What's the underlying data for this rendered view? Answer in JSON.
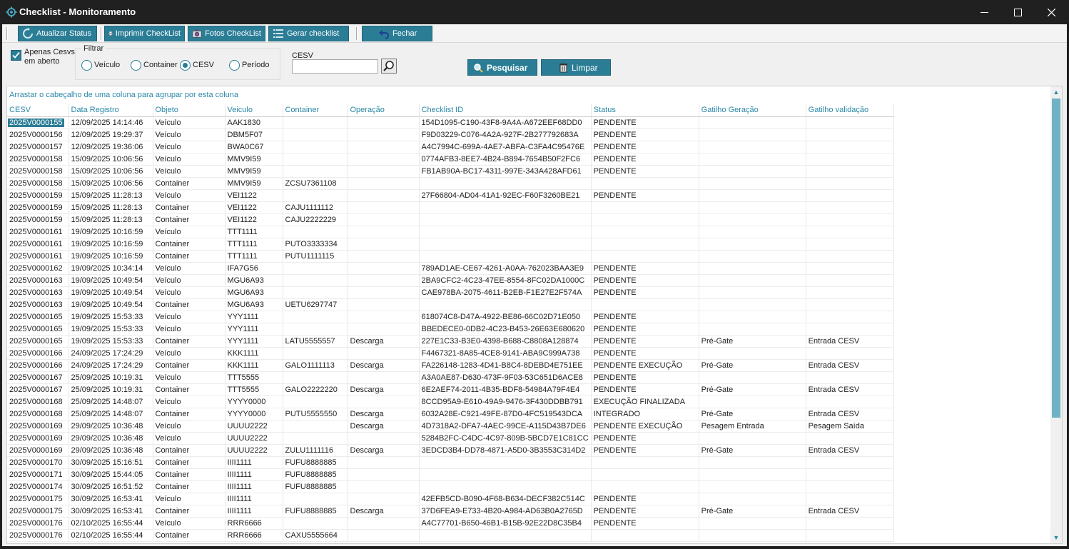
{
  "window": {
    "title": "Checklist - Monitoramento",
    "minimize_icon": "minimize-icon",
    "maximize_icon": "maximize-icon",
    "close_icon": "close-icon"
  },
  "toolbar": {
    "atualizar_label": "Atualizar Status",
    "imprimir_label": "Imprimir CheckList",
    "fotos_label": "Fotos CheckList",
    "gerar_label": "Gerar checklist",
    "fechar_label": "Fechar"
  },
  "filters": {
    "apenas_label": "Apenas Cesvs em aberto",
    "apenas_checked": true,
    "filtrar_title": "Filtrar",
    "options": [
      "Veículo",
      "Container",
      "CESV",
      "Período"
    ],
    "selected": "CESV",
    "cesv_label": "CESV",
    "cesv_value": "",
    "pesquisar_label": "Pesquisar",
    "limpar_label": "Limpar"
  },
  "grid": {
    "group_hint": "Arrastar o cabeçalho de uma coluna para agrupar por esta coluna",
    "columns": [
      "CESV",
      "Data Registro",
      "Objeto",
      "Veiculo",
      "Container",
      "Operação",
      "Checklist ID",
      "Status",
      "Gatilho Geração",
      "Gatilho validação"
    ],
    "rows": [
      [
        "2025V0000155",
        "12/09/2025 14:14:46",
        "Veículo",
        "AAK1830",
        "",
        "",
        "154D1095-C190-43F8-9A4A-A672EEF68DD0",
        "PENDENTE",
        "",
        ""
      ],
      [
        "2025V0000156",
        "12/09/2025 19:29:37",
        "Veículo",
        "DBM5F07",
        "",
        "",
        "F9D03229-C076-4A2A-927F-2B277792683A",
        "PENDENTE",
        "",
        ""
      ],
      [
        "2025V0000157",
        "12/09/2025 19:36:06",
        "Veículo",
        "BWA0C67",
        "",
        "",
        "A4C7994C-699A-4AE7-ABFA-C3FA4C95476E",
        "PENDENTE",
        "",
        ""
      ],
      [
        "2025V0000158",
        "15/09/2025 10:06:56",
        "Veículo",
        "MMV9I59",
        "",
        "",
        "0774AFB3-8EE7-4B24-B894-7654B50F2FC6",
        "PENDENTE",
        "",
        ""
      ],
      [
        "2025V0000158",
        "15/09/2025 10:06:56",
        "Veículo",
        "MMV9I59",
        "",
        "",
        "FB1AB90A-BC17-4311-997E-343A428AFD61",
        "PENDENTE",
        "",
        ""
      ],
      [
        "2025V0000158",
        "15/09/2025 10:06:56",
        "Container",
        "MMV9I59",
        "ZCSU7361108",
        "",
        "",
        "",
        "",
        ""
      ],
      [
        "2025V0000159",
        "15/09/2025 11:28:13",
        "Veículo",
        "VEI1122",
        "",
        "",
        "27F66804-AD04-41A1-92EC-F60F3260BE21",
        "PENDENTE",
        "",
        ""
      ],
      [
        "2025V0000159",
        "15/09/2025 11:28:13",
        "Container",
        "VEI1122",
        "CAJU1111112",
        "",
        "",
        "",
        "",
        ""
      ],
      [
        "2025V0000159",
        "15/09/2025 11:28:13",
        "Container",
        "VEI1122",
        "CAJU2222229",
        "",
        "",
        "",
        "",
        ""
      ],
      [
        "2025V0000161",
        "19/09/2025 10:16:59",
        "Veículo",
        "TTT1111",
        "",
        "",
        "",
        "",
        "",
        ""
      ],
      [
        "2025V0000161",
        "19/09/2025 10:16:59",
        "Container",
        "TTT1111",
        "PUTO3333334",
        "",
        "",
        "",
        "",
        ""
      ],
      [
        "2025V0000161",
        "19/09/2025 10:16:59",
        "Container",
        "TTT1111",
        "PUTU1111115",
        "",
        "",
        "",
        "",
        ""
      ],
      [
        "2025V0000162",
        "19/09/2025 10:34:14",
        "Veículo",
        "IFA7G56",
        "",
        "",
        "789AD1AE-CE67-4261-A0AA-762023BAA3E9",
        "PENDENTE",
        "",
        ""
      ],
      [
        "2025V0000163",
        "19/09/2025 10:49:54",
        "Veículo",
        "MGU6A93",
        "",
        "",
        "2BA9CFC2-4C23-47EE-8554-8FC02DA1000C",
        "PENDENTE",
        "",
        ""
      ],
      [
        "2025V0000163",
        "19/09/2025 10:49:54",
        "Veículo",
        "MGU6A93",
        "",
        "",
        "CAE978BA-2075-4611-B2EB-F1E27E2F574A",
        "PENDENTE",
        "",
        ""
      ],
      [
        "2025V0000163",
        "19/09/2025 10:49:54",
        "Container",
        "MGU6A93",
        "UETU6297747",
        "",
        "",
        "",
        "",
        ""
      ],
      [
        "2025V0000165",
        "19/09/2025 15:53:33",
        "Veículo",
        "YYY1111",
        "",
        "",
        "618074C8-D47A-4922-BE86-66C02D71E050",
        "PENDENTE",
        "",
        ""
      ],
      [
        "2025V0000165",
        "19/09/2025 15:53:33",
        "Veículo",
        "YYY1111",
        "",
        "",
        "BBEDECE0-0DB2-4C23-B453-26E63E680620",
        "PENDENTE",
        "",
        ""
      ],
      [
        "2025V0000165",
        "19/09/2025 15:53:33",
        "Container",
        "YYY1111",
        "LATU5555557",
        "Descarga",
        "227E1C33-B3E0-4398-B688-C8808A128874",
        "PENDENTE",
        "Pré-Gate",
        "Entrada CESV"
      ],
      [
        "2025V0000166",
        "24/09/2025 17:24:29",
        "Veículo",
        "KKK1111",
        "",
        "",
        "F4467321-8A85-4CE8-9141-ABA9C999A738",
        "PENDENTE",
        "",
        ""
      ],
      [
        "2025V0000166",
        "24/09/2025 17:24:29",
        "Container",
        "KKK1111",
        "GALO1111113",
        "Descarga",
        "FA226148-1283-4D41-B8C4-8DEBD4E751EE",
        "PENDENTE EXECUÇÃO",
        "Pré-Gate",
        "Entrada CESV"
      ],
      [
        "2025V0000167",
        "25/09/2025 10:19:31",
        "Veículo",
        "TTT5555",
        "",
        "",
        "A3A0AE87-D630-473F-9F03-53C651D6ACE8",
        "PENDENTE",
        "",
        ""
      ],
      [
        "2025V0000167",
        "25/09/2025 10:19:31",
        "Container",
        "TTT5555",
        "GALO2222220",
        "Descarga",
        "6E2AEF74-2011-4B35-BDF8-54984A79F4E4",
        "PENDENTE",
        "Pré-Gate",
        "Entrada CESV"
      ],
      [
        "2025V0000168",
        "25/09/2025 14:48:07",
        "Veículo",
        "YYYY0000",
        "",
        "",
        "8CCD95A9-E610-49A9-9476-3F430DDBB791",
        "EXECUÇÃO FINALIZADA",
        "",
        ""
      ],
      [
        "2025V0000168",
        "25/09/2025 14:48:07",
        "Container",
        "YYYY0000",
        "PUTU5555550",
        "Descarga",
        "6032A28E-C921-49FE-87D0-4FC519543DCA",
        "INTEGRADO",
        "Pré-Gate",
        "Entrada CESV"
      ],
      [
        "2025V0000169",
        "29/09/2025 10:36:48",
        "Veículo",
        "UUUU2222",
        "",
        "Descarga",
        "4D7318A2-DFA7-4AEC-99CE-A115D43B7DE6",
        "PENDENTE EXECUÇÃO",
        "Pesagem Entrada",
        "Pesagem Saída"
      ],
      [
        "2025V0000169",
        "29/09/2025 10:36:48",
        "Veículo",
        "UUUU2222",
        "",
        "",
        "5284B2FC-C4DC-4C97-809B-5BCD7E1C81CC",
        "PENDENTE",
        "",
        ""
      ],
      [
        "2025V0000169",
        "29/09/2025 10:36:48",
        "Container",
        "UUUU2222",
        "ZULU1111116",
        "Descarga",
        "3EDCD3B4-DD78-4871-A5D0-3B3553C314D2",
        "PENDENTE",
        "Pré-Gate",
        "Entrada CESV"
      ],
      [
        "2025V0000170",
        "30/09/2025 15:16:51",
        "Container",
        "IIII1111",
        "FUFU8888885",
        "",
        "",
        "",
        "",
        ""
      ],
      [
        "2025V0000171",
        "30/09/2025 15:44:05",
        "Container",
        "IIII1111",
        "FUFU8888885",
        "",
        "",
        "",
        "",
        ""
      ],
      [
        "2025V0000174",
        "30/09/2025 16:51:52",
        "Container",
        "IIII1111",
        "FUFU8888885",
        "",
        "",
        "",
        "",
        ""
      ],
      [
        "2025V0000175",
        "30/09/2025 16:53:41",
        "Veículo",
        "IIII1111",
        "",
        "",
        "42EFB5CD-B090-4F68-B634-DECF382C514C",
        "PENDENTE",
        "",
        ""
      ],
      [
        "2025V0000175",
        "30/09/2025 16:53:41",
        "Container",
        "IIII1111",
        "FUFU8888885",
        "Descarga",
        "37D6FEA9-E733-4B20-A984-AD63B0A2765D",
        "PENDENTE",
        "Pré-Gate",
        "Entrada CESV"
      ],
      [
        "2025V0000176",
        "02/10/2025 16:55:44",
        "Veículo",
        "RRR6666",
        "",
        "",
        "A4C77701-B650-46B1-B15B-92E22D8C35B4",
        "PENDENTE",
        "",
        ""
      ],
      [
        "2025V0000176",
        "02/10/2025 16:55:44",
        "Container",
        "RRR6666",
        "CAXU5555664",
        "",
        "",
        "",
        "",
        ""
      ]
    ]
  },
  "colors": {
    "accent": "#2b7d96",
    "header_text": "#2b88a8",
    "titlebar": "#202020"
  }
}
